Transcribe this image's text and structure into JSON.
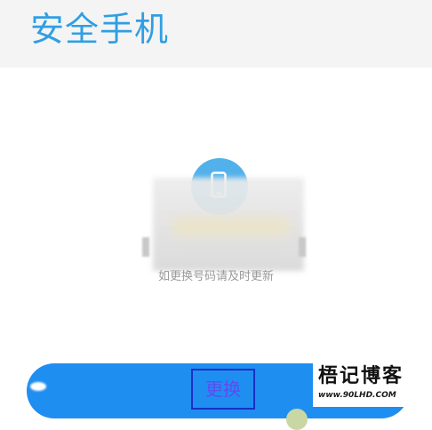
{
  "header": {
    "title": "安全手机"
  },
  "main": {
    "phone_icon": "phone-icon",
    "hint": "如更换号码请及时更新"
  },
  "actions": {
    "change_label": "更换"
  },
  "watermark": {
    "title": "梧记博客",
    "url": "www.90LHD.COM"
  },
  "colors": {
    "accent": "#2f9fe3",
    "button": "#1f8ef1",
    "icon_circle": "#52b1ea"
  }
}
